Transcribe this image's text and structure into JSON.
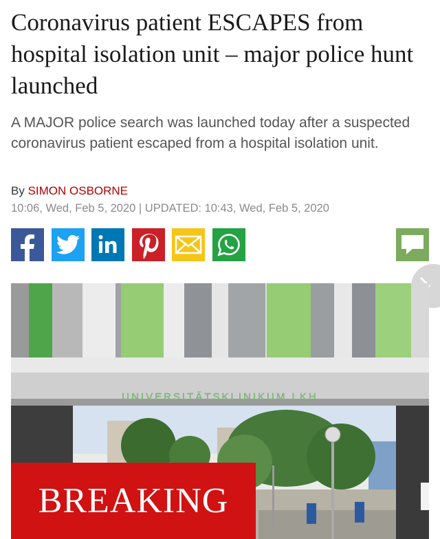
{
  "article": {
    "headline": "Coronavirus patient ESCAPES from hospital isolation unit – major police hunt launched",
    "standfirst": "A MAJOR police search was launched today after a suspected coronavirus patient escaped from a hospital isolation unit.",
    "byline_prefix": "By ",
    "author": "SIMON OSBORNE",
    "dateline": "10:06, Wed, Feb 5, 2020 | UPDATED: 10:43, Wed, Feb 5, 2020"
  },
  "share_icons": [
    "facebook-icon",
    "twitter-icon",
    "linkedin-icon",
    "pinterest-icon",
    "email-icon",
    "whatsapp-icon",
    "comments-icon"
  ],
  "colors": {
    "facebook": "#3b5998",
    "twitter": "#1da1f2",
    "linkedin": "#0077b5",
    "pinterest": "#cb2027",
    "email": "#f5c518",
    "whatsapp": "#25a244",
    "comments": "#7cab5f",
    "breaking": "#d01212",
    "author": "#b30000"
  },
  "photo": {
    "sign_text": "UNIVERSITÄTSKLINIKUM LKH",
    "banner": "BREAKING"
  }
}
